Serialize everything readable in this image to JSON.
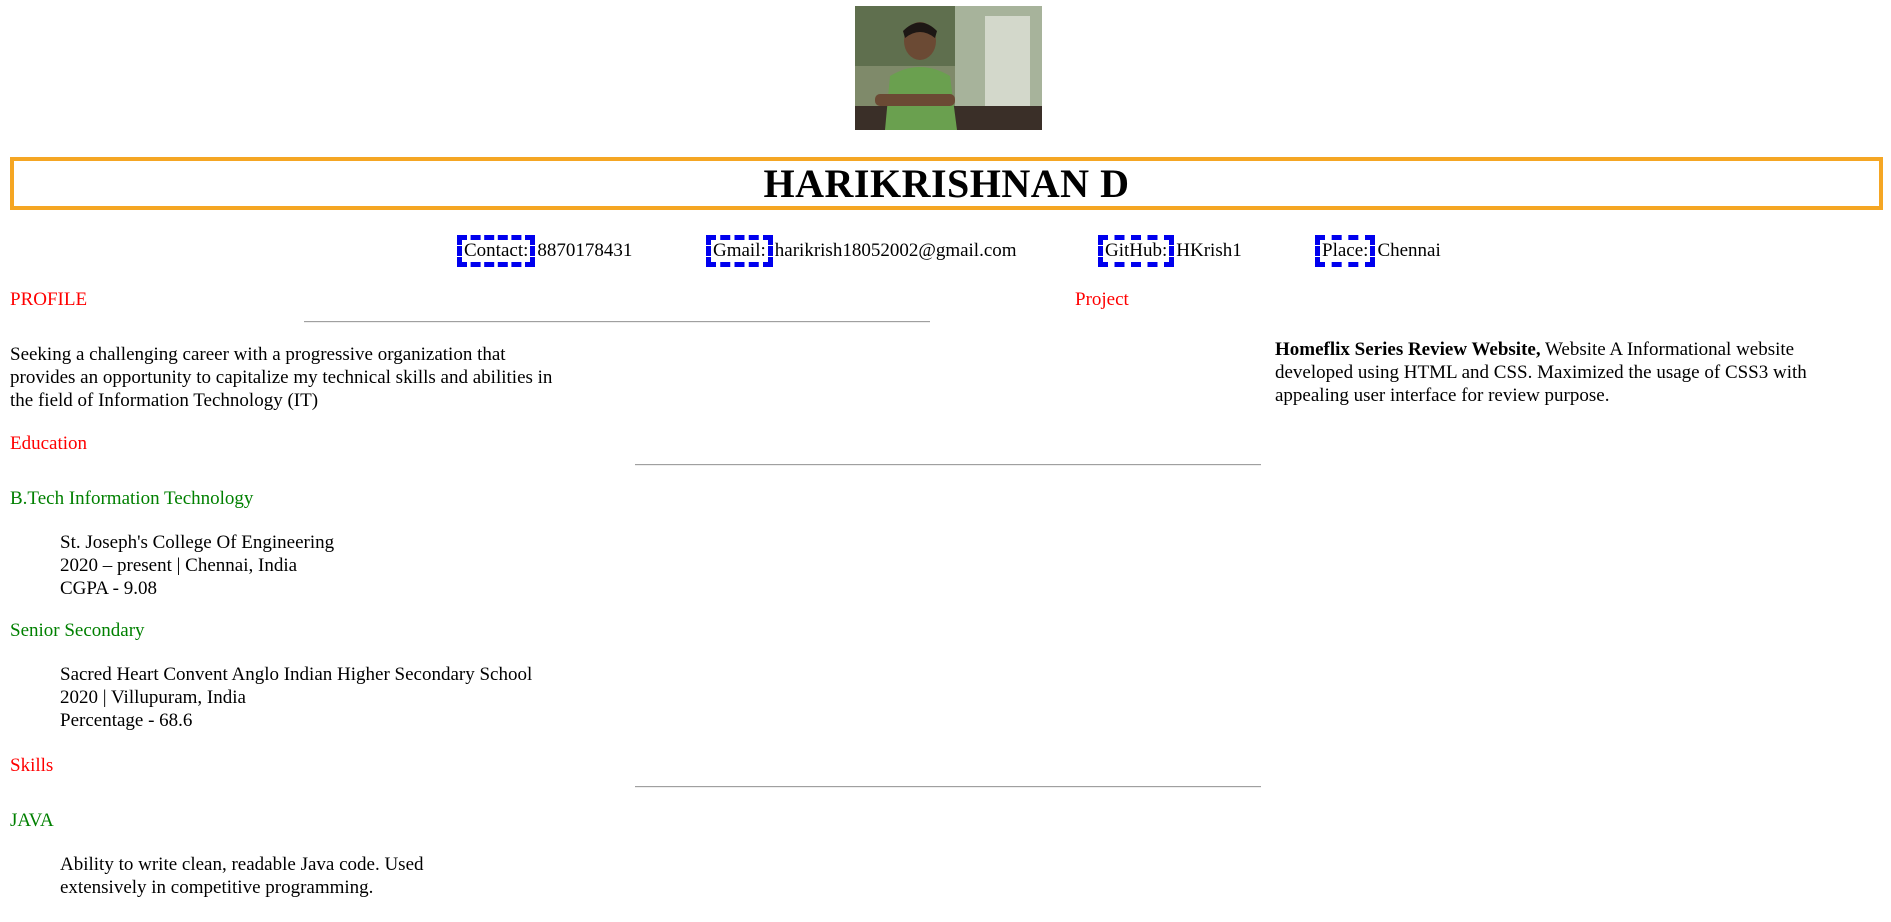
{
  "header": {
    "name": "HARIKRISHNAN D",
    "photo_icon": "profile-photo"
  },
  "contacts": [
    {
      "label": "Contact:",
      "value": "8870178431"
    },
    {
      "label": "Gmail:",
      "value": "harikrish18052002@gmail.com"
    },
    {
      "label": "GitHub:",
      "value": "HKrish1"
    },
    {
      "label": "Place:",
      "value": "Chennai"
    }
  ],
  "profile": {
    "title": "PROFILE",
    "text": "Seeking a challenging career with a progressive organization that provides an opportunity to capitalize my technical skills and abilities in the field of Information Technology (IT)"
  },
  "project": {
    "title": "Project",
    "name": "Homeflix Series Review Website,",
    "description": " Website A Informational website developed using HTML and CSS. Maximized the usage of CSS3 with appealing user interface for review purpose."
  },
  "education": {
    "title": "Education",
    "items": [
      {
        "degree": "B.Tech Information Technology",
        "lines": [
          "St. Joseph's College Of Engineering",
          "2020 – present | Chennai, India",
          "CGPA - 9.08"
        ]
      },
      {
        "degree": "Senior Secondary",
        "lines": [
          "Sacred Heart Convent Anglo Indian Higher Secondary School",
          "2020 | Villupuram, India",
          "Percentage - 68.6"
        ]
      }
    ]
  },
  "skills": {
    "title": "Skills",
    "items": [
      {
        "name": "JAVA",
        "lines": [
          "Ability to write clean, readable Java code. Used",
          "extensively in competitive programming."
        ]
      }
    ]
  }
}
